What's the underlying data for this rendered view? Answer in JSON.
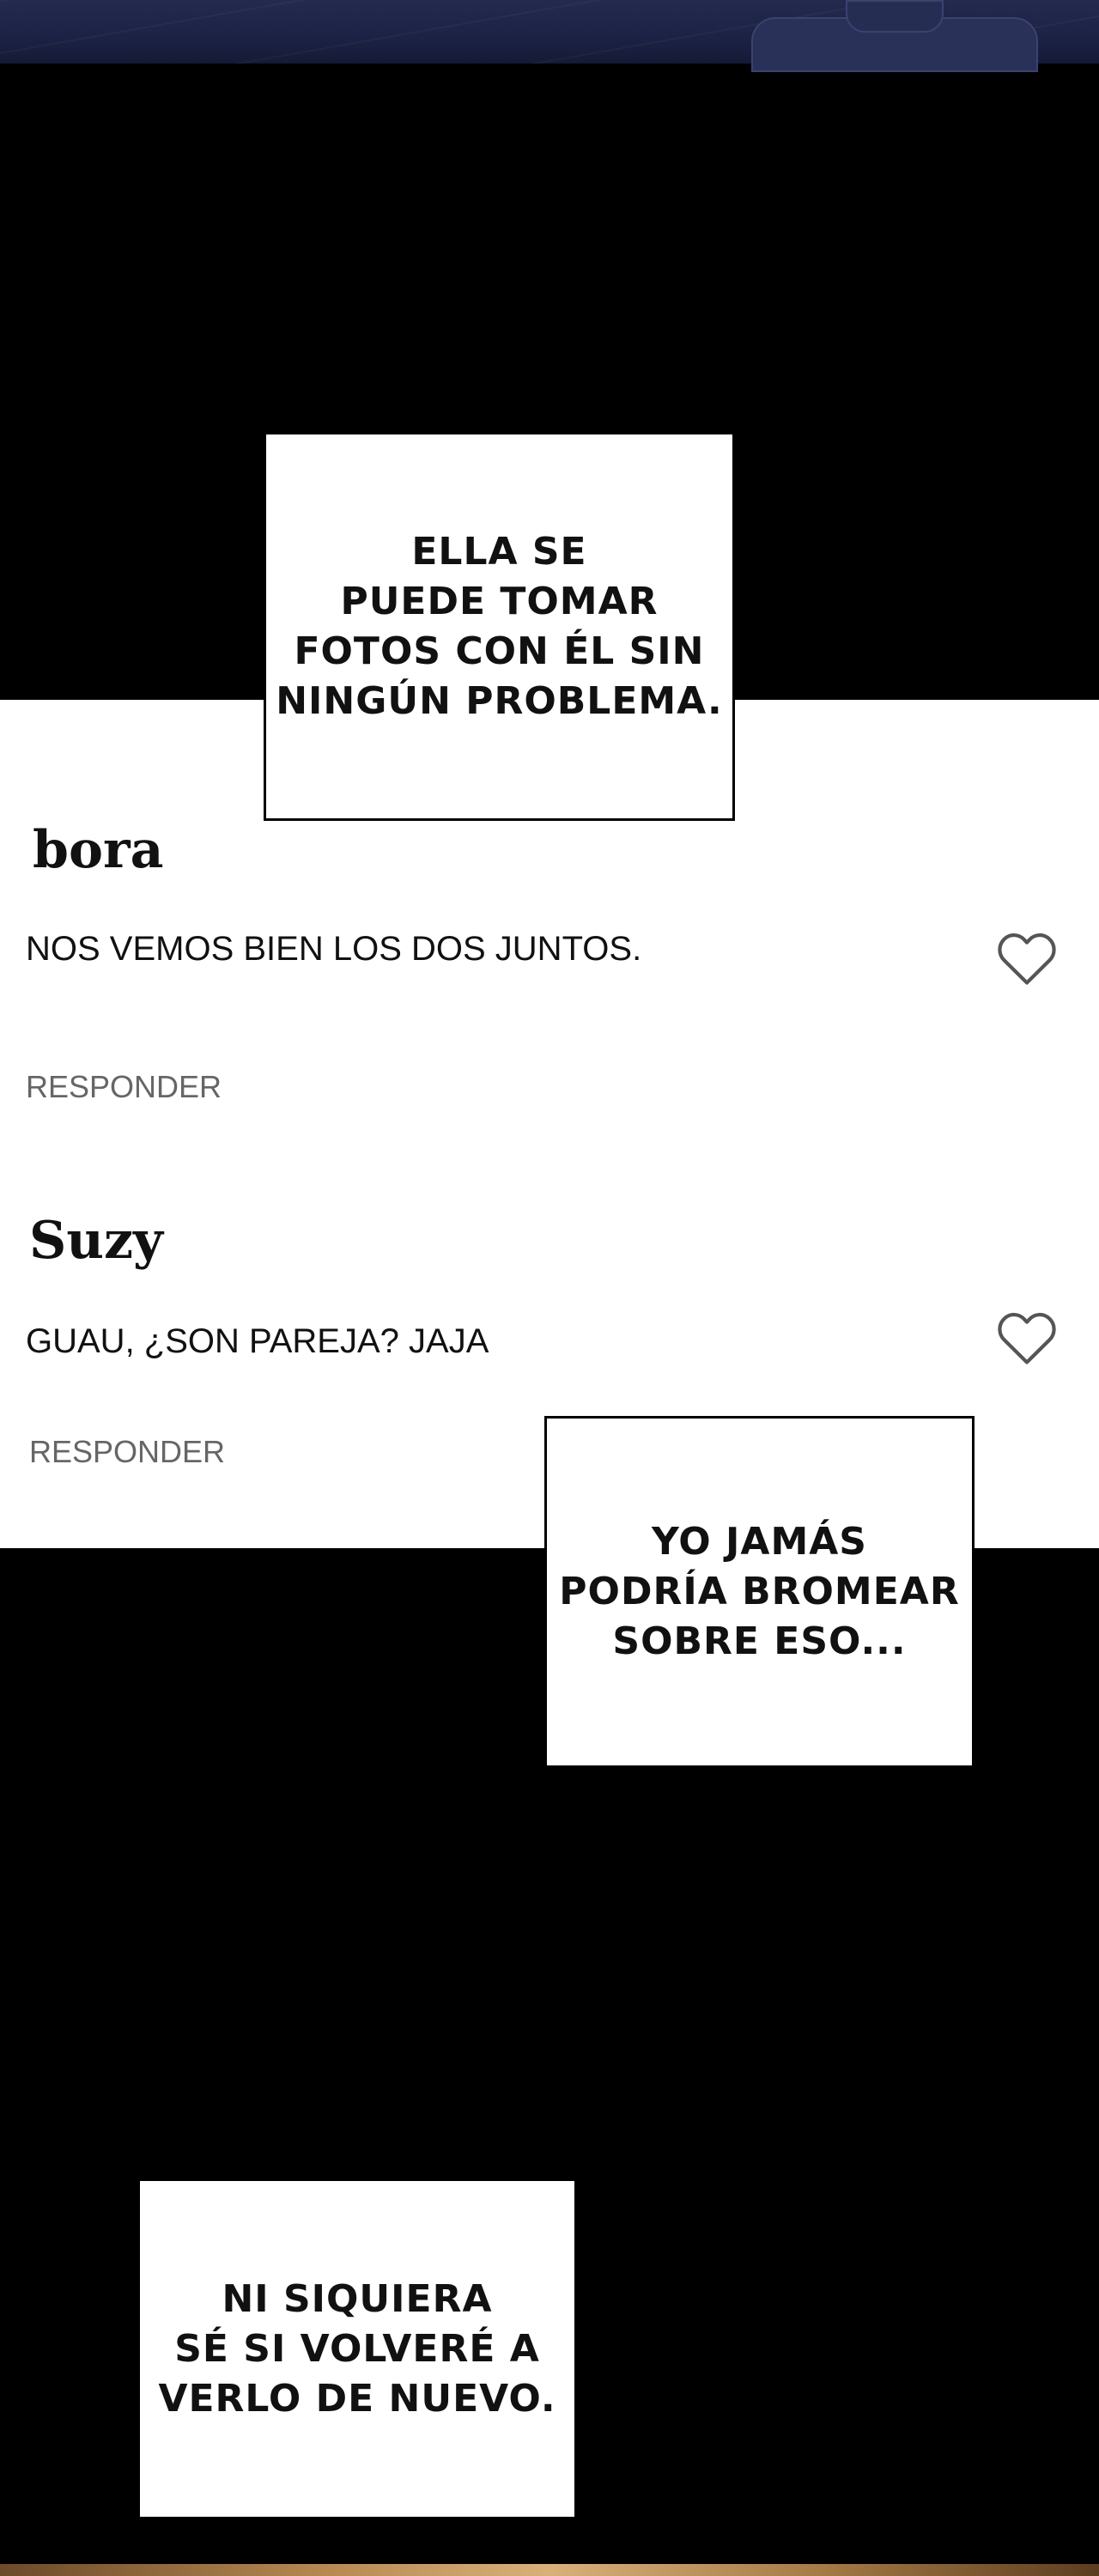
{
  "comments": [
    {
      "username": "bora",
      "text": "NOS VEMOS BIEN LOS DOS JUNTOS.",
      "reply_label": "RESPONDER"
    },
    {
      "username": "Suzy",
      "text": "GUAU, ¿SON PAREJA? JAJA",
      "reply_label": "RESPONDER"
    }
  ],
  "bubbles": [
    {
      "text": "ELLA SE\nPUEDE TOMAR\nFOTOS CON ÉL SIN\nNINGÚN PROBLEMA."
    },
    {
      "text": "YO JAMÁS\nPODRÍA BROMEAR\nSOBRE ESO..."
    },
    {
      "text": "NI SIQUIERA\nSÉ SI VOLVERÉ A\nVERLO DE NUEVO."
    }
  ],
  "icons": {
    "like": "heart-outline-icon"
  },
  "colors": {
    "background": "#000000",
    "comment_bg": "#ffffff",
    "reply_text": "#666666",
    "top_panel": "#1c2244"
  }
}
